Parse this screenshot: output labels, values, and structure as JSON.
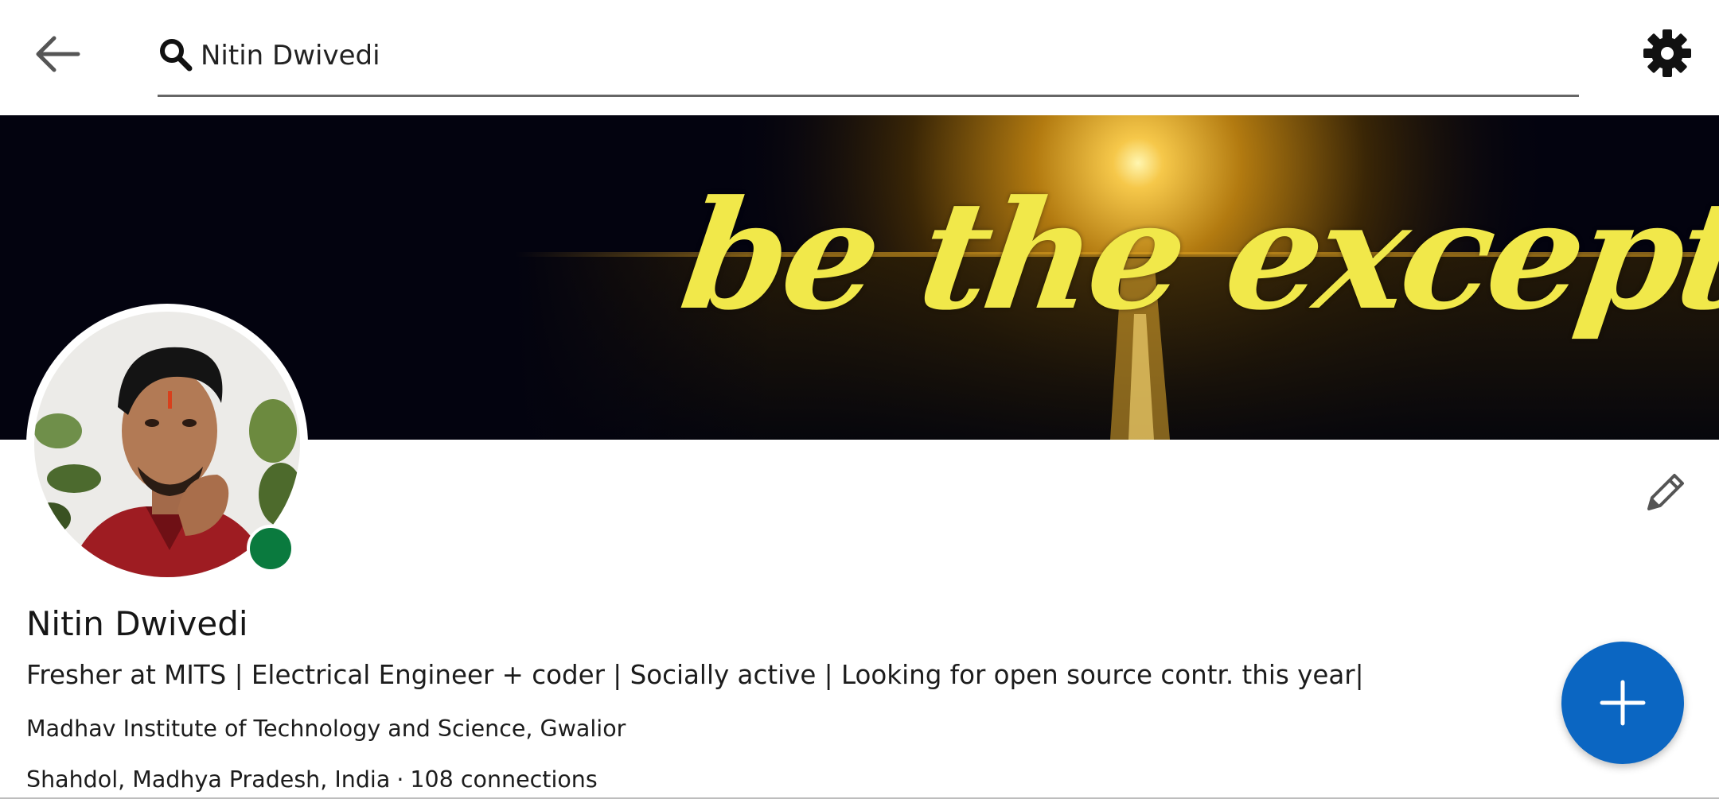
{
  "search": {
    "value": "Nitin Dwivedi"
  },
  "icons": {
    "back": "arrow-left-icon",
    "search": "search-icon",
    "settings": "gear-icon",
    "edit": "pencil-icon",
    "add": "plus-icon"
  },
  "cover": {
    "text": "be the exception"
  },
  "profile": {
    "name": "Nitin Dwivedi",
    "headline": "Fresher at MITS | Electrical Engineer + coder | Socially active | Looking for open source contr. this year|",
    "school": "Madhav Institute of Technology and Science, Gwalior",
    "location": "Shahdol, Madhya Pradesh, India",
    "separator": "·",
    "connections": "108 connections",
    "status": "online"
  },
  "colors": {
    "accent": "#0b66c2",
    "presence": "#0a7a3e",
    "cover_text": "#f1e84a",
    "cover_bg": "#03030f"
  }
}
